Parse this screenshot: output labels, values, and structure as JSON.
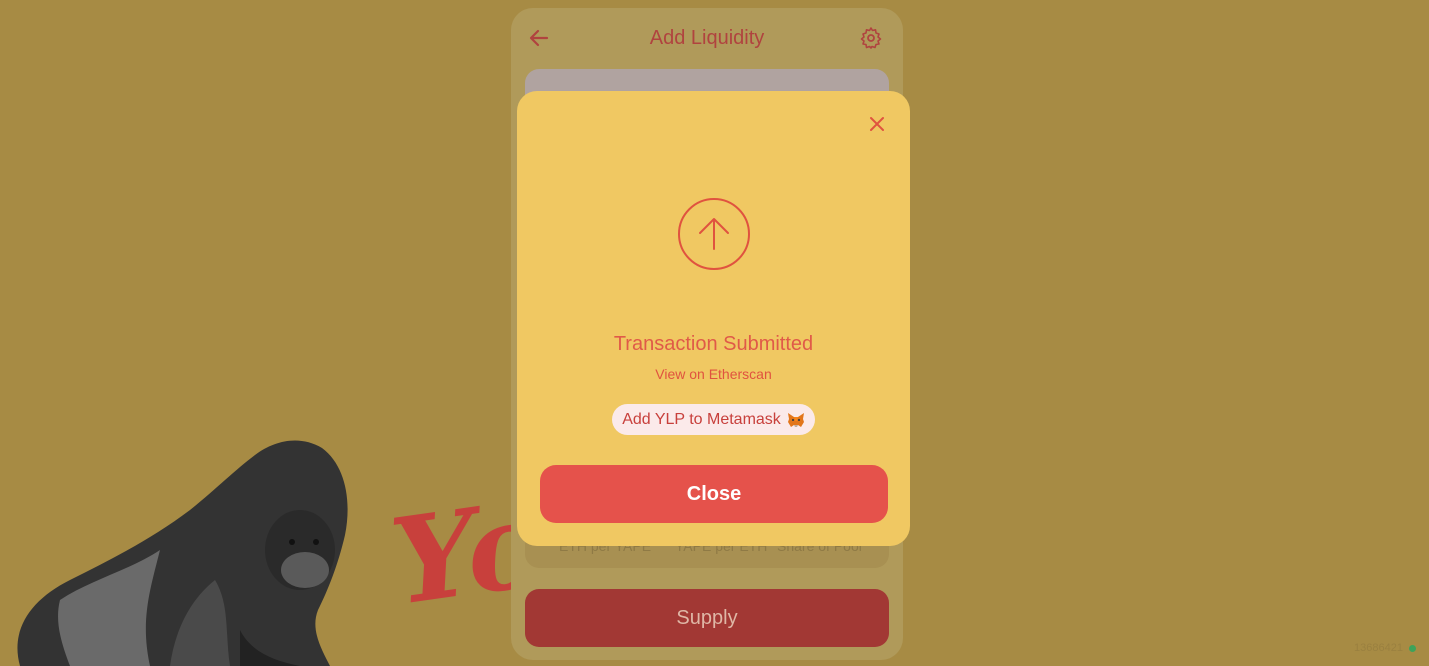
{
  "background": {
    "brand_text": "Yo",
    "mascot_icon": "gorilla-illustration"
  },
  "card": {
    "title": "Add Liquidity",
    "back_icon": "arrow-left-icon",
    "settings_icon": "gear-icon",
    "price_labels": [
      "ETH per YAPE",
      "YAPE per ETH",
      "Share of Pool"
    ],
    "supply_label": "Supply"
  },
  "modal": {
    "close_icon": "close-icon",
    "status_icon": "arrow-up-circle-icon",
    "title": "Transaction Submitted",
    "link_label": "View on Etherscan",
    "metamask_label": "Add YLP to Metamask",
    "metamask_icon": "metamask-fox-icon",
    "close_button_label": "Close"
  },
  "footer": {
    "block_number": "13686421"
  },
  "colors": {
    "page_background": "#a78b44",
    "modal_background": "#f0c862",
    "accent": "#e5524b",
    "title_red": "#e05a48",
    "status_dot": "#3da35a"
  }
}
